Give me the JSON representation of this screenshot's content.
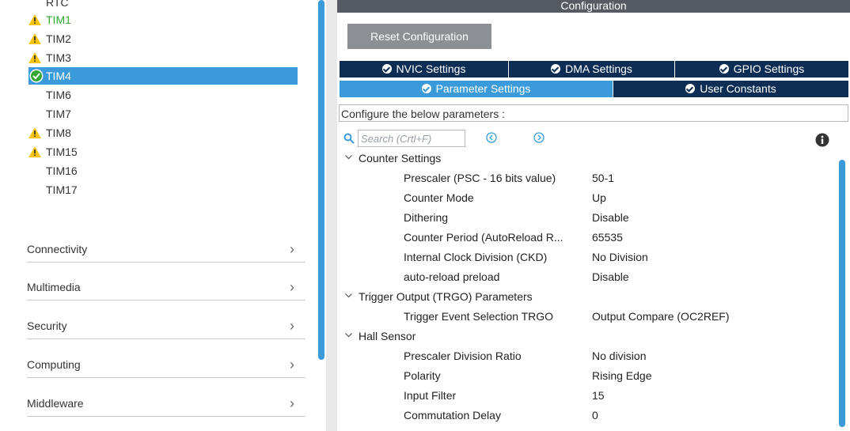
{
  "left": {
    "timers": [
      {
        "label": "RTC",
        "warning": false,
        "state": "partial"
      },
      {
        "label": "TIM1",
        "warning": true,
        "state": "green"
      },
      {
        "label": "TIM2",
        "warning": true,
        "state": "normal"
      },
      {
        "label": "TIM3",
        "warning": true,
        "state": "normal"
      },
      {
        "label": "TIM4",
        "warning": false,
        "state": "selected"
      },
      {
        "label": "TIM6",
        "warning": false,
        "state": "normal"
      },
      {
        "label": "TIM7",
        "warning": false,
        "state": "normal"
      },
      {
        "label": "TIM8",
        "warning": true,
        "state": "normal"
      },
      {
        "label": "TIM15",
        "warning": true,
        "state": "normal"
      },
      {
        "label": "TIM16",
        "warning": false,
        "state": "normal"
      },
      {
        "label": "TIM17",
        "warning": false,
        "state": "normal"
      }
    ],
    "categories": [
      {
        "label": "Connectivity",
        "icon": "chevron-right-icon"
      },
      {
        "label": "Multimedia",
        "icon": "chevron-right-icon"
      },
      {
        "label": "Security",
        "icon": "chevron-right-icon"
      },
      {
        "label": "Computing",
        "icon": "chevron-right-icon"
      },
      {
        "label": "Middleware",
        "icon": "chevron-right-icon"
      }
    ]
  },
  "right": {
    "header_title": "Configuration",
    "reset_label": "Reset Configuration",
    "tabs_top": [
      "NVIC Settings",
      "DMA Settings",
      "GPIO Settings"
    ],
    "tabs_bottom": [
      "Parameter Settings",
      "User Constants"
    ],
    "active_tab": "Parameter Settings",
    "description": "Configure the below parameters :",
    "search_placeholder": "Search (Crtl+F)",
    "groups": [
      {
        "title": "Counter Settings",
        "params": [
          {
            "name": "Prescaler (PSC - 16 bits value)",
            "value": "50-1"
          },
          {
            "name": "Counter Mode",
            "value": "Up"
          },
          {
            "name": "Dithering",
            "value": "Disable"
          },
          {
            "name": "Counter Period (AutoReload R...",
            "value": "65535"
          },
          {
            "name": "Internal Clock Division (CKD)",
            "value": "No Division"
          },
          {
            "name": "auto-reload preload",
            "value": "Disable"
          }
        ]
      },
      {
        "title": "Trigger Output (TRGO) Parameters",
        "params": [
          {
            "name": "Trigger Event Selection TRGO",
            "value": "Output Compare (OC2REF)"
          }
        ]
      },
      {
        "title": "Hall Sensor",
        "params": [
          {
            "name": "Prescaler Division Ratio",
            "value": "No division"
          },
          {
            "name": "Polarity",
            "value": "Rising Edge"
          },
          {
            "name": "Input Filter",
            "value": "15"
          },
          {
            "name": "Commutation Delay",
            "value": "0"
          }
        ]
      }
    ]
  },
  "colors": {
    "accent": "#3b9ad9",
    "tab_dark": "#0d2d55",
    "header": "#555b61",
    "warning": "#f5c518",
    "green": "#33a833"
  }
}
